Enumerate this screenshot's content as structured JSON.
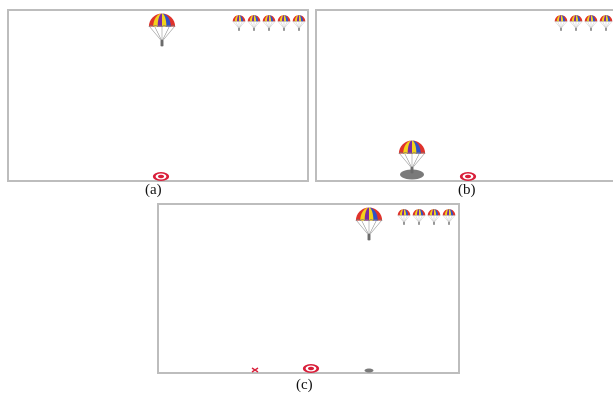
{
  "figure": {
    "panels": [
      {
        "id": "a",
        "caption": "(a)",
        "lives_remaining": 5,
        "parachute_state": "falling-top",
        "landing": "none"
      },
      {
        "id": "b",
        "caption": "(b)",
        "lives_remaining": 4,
        "parachute_state": "landed",
        "landing": "shadow-near-target"
      },
      {
        "id": "c",
        "caption": "(c)",
        "lives_remaining": 4,
        "parachute_state": "falling-top",
        "landing": "miss-marker"
      }
    ]
  },
  "icons": {
    "parachute": "parachute-icon",
    "target": "bullseye-target-icon",
    "shadow": "landing-shadow-icon",
    "miss": "miss-x-icon"
  },
  "colors": {
    "canopy_red": "#e0322b",
    "canopy_yellow": "#f3d21b",
    "canopy_blue": "#2f51c8",
    "canopy_purple": "#7b2aa3",
    "target_red": "#d91f3a",
    "panel_border": "#bdbdbd",
    "shadow_gray": "#7a7a7a"
  }
}
